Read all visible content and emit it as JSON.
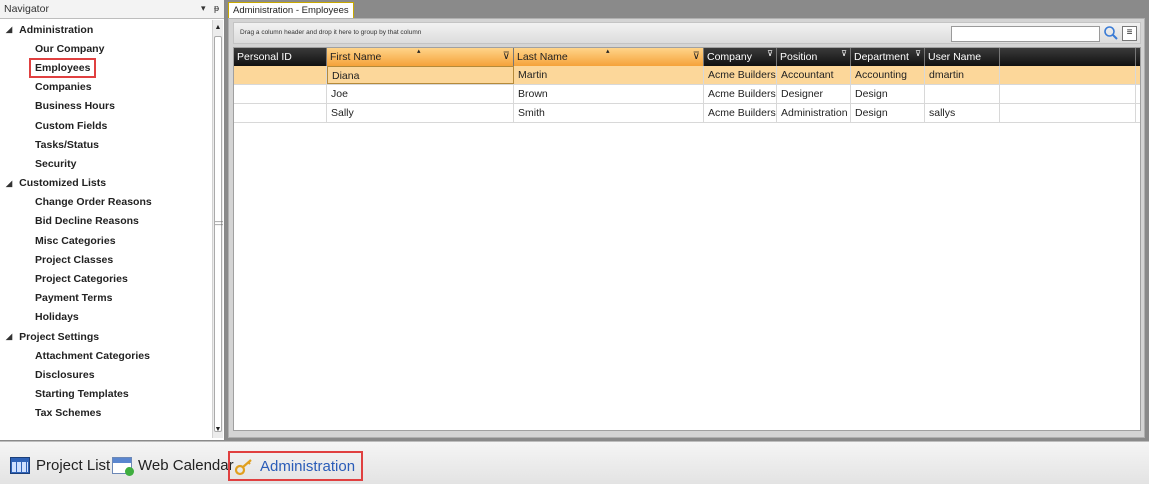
{
  "navigator": {
    "title": "Navigator",
    "dropdown_glyph": "▾",
    "pin_glyph": "ᵽ",
    "groups": [
      {
        "label": "Administration",
        "items": [
          "Our Company",
          "Employees",
          "Companies",
          "Business Hours",
          "Custom Fields",
          "Tasks/Status",
          "Security"
        ]
      },
      {
        "label": "Customized Lists",
        "items": [
          "Change Order Reasons",
          "Bid Decline Reasons",
          "Misc Categories",
          "Project Classes",
          "Project Categories",
          "Payment Terms",
          "Holidays"
        ]
      },
      {
        "label": "Project Settings",
        "items": [
          "Attachment Categories",
          "Disclosures",
          "Starting Templates",
          "Tax Schemes"
        ]
      }
    ],
    "selected_item": "Employees"
  },
  "document": {
    "tab_label": "Administration - Employees",
    "group_hint": "Drag a column header and drop it here to group by that column",
    "search_value": ""
  },
  "grid": {
    "columns": [
      "Personal ID",
      "First Name",
      "Last Name",
      "Company",
      "Position",
      "Department",
      "User Name",
      ""
    ],
    "rows": [
      [
        "",
        "Diana",
        "Martin",
        "Acme Builders",
        "Accountant",
        "Accounting",
        "dmartin",
        ""
      ],
      [
        "",
        "Joe",
        "Brown",
        "Acme Builders",
        "Designer",
        "Design",
        "",
        ""
      ],
      [
        "",
        "Sally",
        "Smith",
        "Acme Builders",
        "Administration",
        "Design",
        "sallys",
        ""
      ]
    ],
    "selected_row": 0
  },
  "bottom_bar": {
    "buttons": [
      {
        "label": "Project List",
        "icon": "grid-icon"
      },
      {
        "label": "Web Calendar",
        "icon": "calendar-icon"
      },
      {
        "label": "Administration",
        "icon": "key-icon",
        "active": true
      }
    ]
  },
  "colors": {
    "accent_orange": "#f5a23a",
    "selected_row": "#fcd79a",
    "highlight_red": "#e04040",
    "active_blue": "#2a5cb8"
  }
}
